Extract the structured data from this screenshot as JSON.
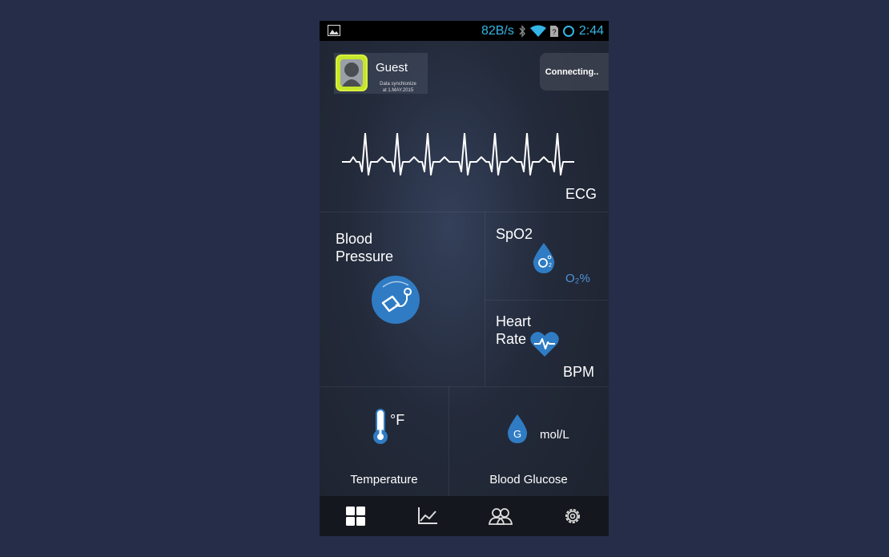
{
  "status_bar": {
    "net_speed": "82B/s",
    "time": "2:44",
    "icons": [
      "gallery-icon",
      "bluetooth-icon",
      "wifi-icon",
      "no-sim-icon",
      "sync-ring-icon"
    ]
  },
  "profile": {
    "name": "Guest",
    "sync_line1": "Data synchionize",
    "sync_line2": "at 1.MAY.2015"
  },
  "connection": {
    "status": "Connecting.."
  },
  "tiles": {
    "ecg": {
      "label": "ECG"
    },
    "blood_pressure": {
      "label_line1": "Blood",
      "label_line2": "Pressure",
      "icon": "blood-pressure-cuff-icon"
    },
    "spo2": {
      "label": "SpO2",
      "unit": "O₂%",
      "icon": "oxygen-drop-icon"
    },
    "heart_rate": {
      "label_line1": "Heart",
      "label_line2": "Rate",
      "unit": "BPM",
      "icon": "heart-pulse-icon"
    },
    "temperature": {
      "label": "Temperature",
      "unit": "°F",
      "icon": "thermometer-icon"
    },
    "blood_glucose": {
      "label": "Blood Glucose",
      "unit": "mol/L",
      "icon_letter": "G",
      "icon": "glucose-drop-icon"
    }
  },
  "nav": [
    "dashboard-icon",
    "chart-icon",
    "community-icon",
    "settings-icon"
  ],
  "colors": {
    "accent": "#2f7cc4",
    "status_blue": "#34b5e5",
    "avatar_green": "#c5e62a"
  }
}
